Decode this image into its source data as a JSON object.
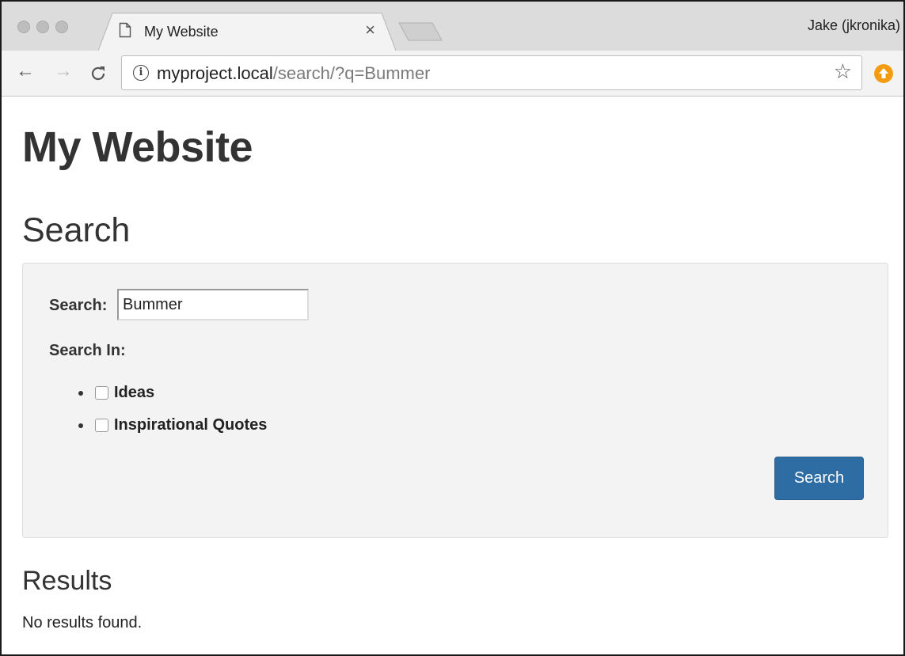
{
  "browser": {
    "tab": {
      "title": "My Website",
      "close_glyph": "×",
      "icon": "page-icon"
    },
    "profile": "Jake (jkronika)",
    "toolbar": {
      "back_glyph": "←",
      "forward_glyph": "→",
      "reload_glyph": "C",
      "info_glyph": "i",
      "url_host": "myproject.local",
      "url_path": "/search/?q=Bummer",
      "star_glyph": "☆",
      "update_color": "#f39c12"
    }
  },
  "page": {
    "site_title": "My Website",
    "search_heading": "Search",
    "form": {
      "search_label": "Search:",
      "search_value": "Bummer",
      "search_in_label": "Search In:",
      "options": [
        {
          "label": "Ideas",
          "checked": false
        },
        {
          "label": "Inspirational Quotes",
          "checked": false
        }
      ],
      "submit_label": "Search",
      "button_color": "#2e6da4"
    },
    "results_heading": "Results",
    "results_message": "No results found."
  }
}
